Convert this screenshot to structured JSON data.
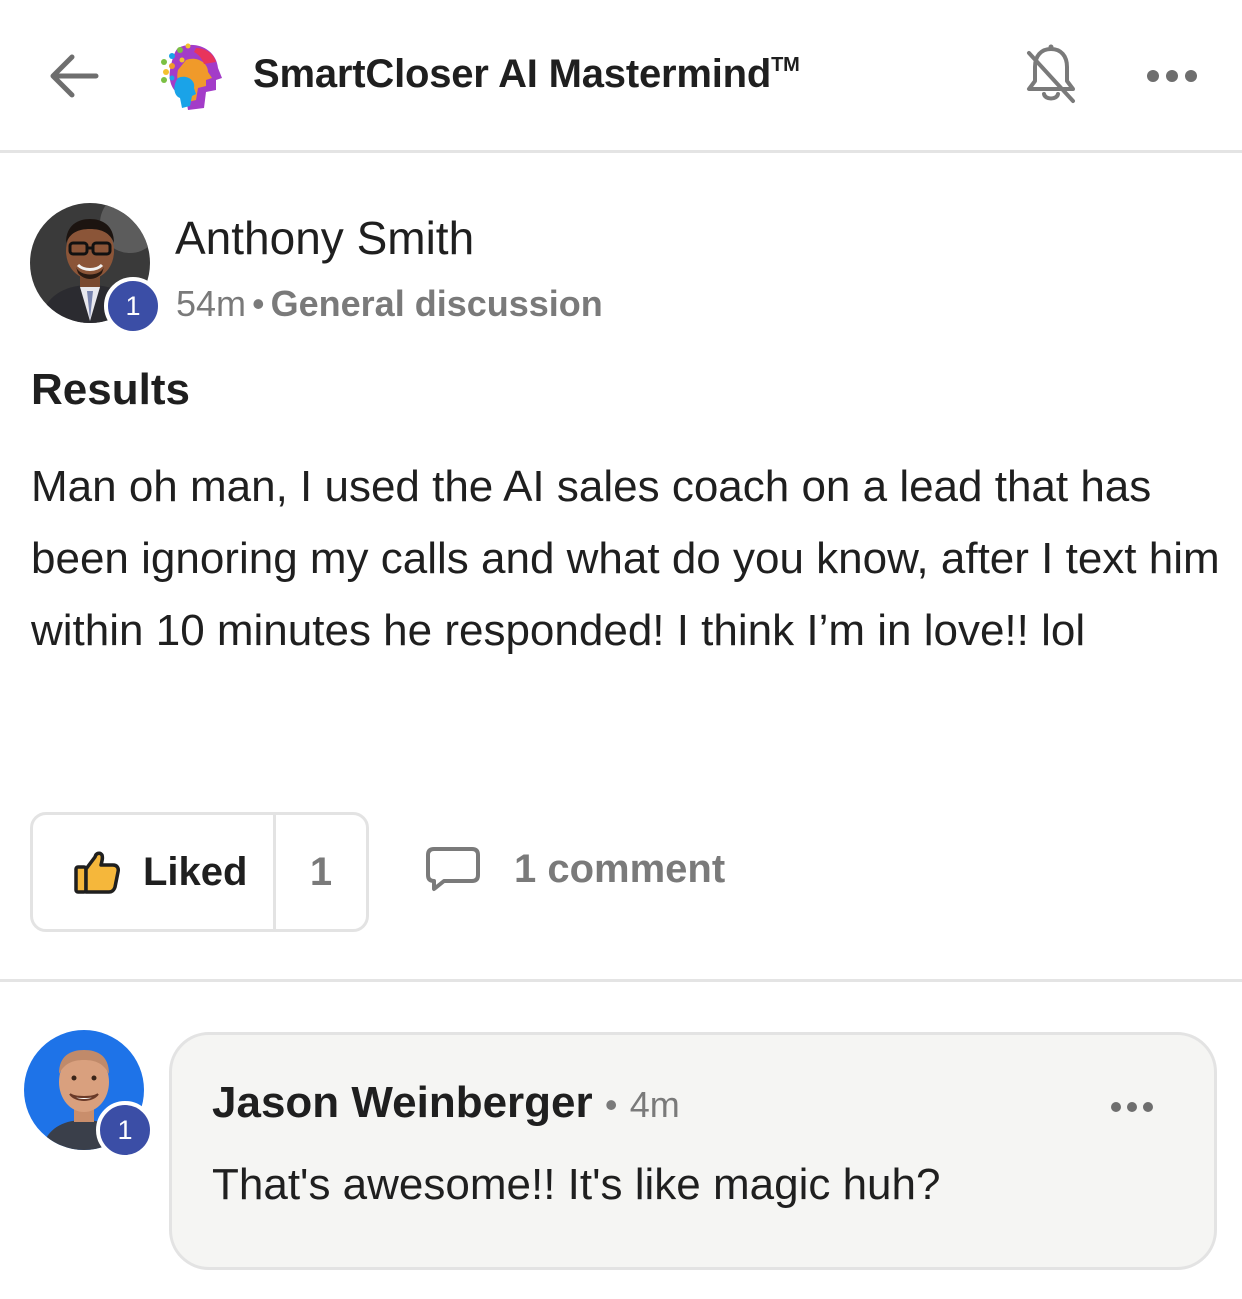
{
  "header": {
    "back_icon": "arrow-left-icon",
    "logo_icon": "brain-logo-icon",
    "title": "SmartCloser AI Mastermind",
    "title_mark": "TM",
    "notification_icon": "bell-off-icon",
    "more_icon": "more-horizontal-icon"
  },
  "post": {
    "author": {
      "name": "Anthony Smith",
      "level": "1"
    },
    "time": "54m",
    "separator": "•",
    "category": "General discussion",
    "title": "Results",
    "body": "Man oh man, I used the AI sales coach on a lead that has been ignoring my calls and what do you know, after I text him within 10 minutes he responded! I think I’m in love!! lol",
    "actions": {
      "like_icon": "thumbs-up-icon",
      "like_label": "Liked",
      "like_count": "1",
      "comment_icon": "comment-bubble-icon",
      "comment_label": "1 comment"
    }
  },
  "comments": [
    {
      "author": "Jason Weinberger",
      "level": "1",
      "separator": "•",
      "time": "4m",
      "text": "That's awesome!! It's like magic huh?"
    }
  ],
  "colors": {
    "badge": "#3b4ea6",
    "muted_text": "#7a7a7a",
    "like_icon": "#f5b73b",
    "comment_avatar_bg": "#1e73e8",
    "bubble_bg": "#f5f5f3"
  }
}
